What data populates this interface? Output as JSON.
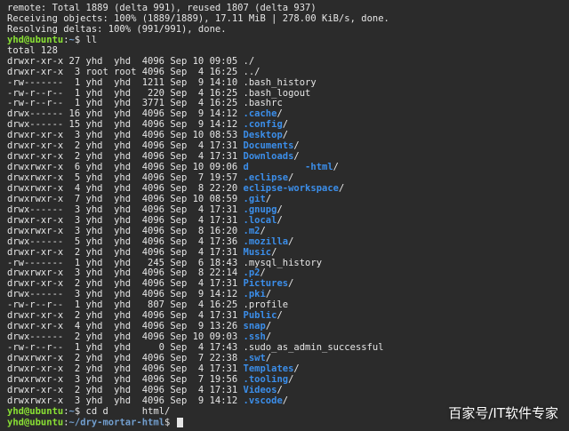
{
  "output_lines": [
    "remote: Total 1889 (delta 991), reused 1807 (delta 937)",
    "Receiving objects: 100% (1889/1889), 17.11 MiB | 278.00 KiB/s, done.",
    "Resolving deltas: 100% (991/991), done."
  ],
  "prompt1": {
    "user": "yhd@ubuntu",
    "sep": ":",
    "path": "~",
    "symbol": "$ ",
    "command": "ll"
  },
  "total": "total 128",
  "listing": [
    {
      "meta": "drwxr-xr-x 27 yhd  yhd  4096 Sep 10 09:05 ",
      "name": "./",
      "dir": false
    },
    {
      "meta": "drwxr-xr-x  3 root root 4096 Sep  4 16:25 ",
      "name": "../",
      "dir": false
    },
    {
      "meta": "-rw-------  1 yhd  yhd  1211 Sep  9 14:10 ",
      "name": ".bash_history",
      "dir": false
    },
    {
      "meta": "-rw-r--r--  1 yhd  yhd   220 Sep  4 16:25 ",
      "name": ".bash_logout",
      "dir": false
    },
    {
      "meta": "-rw-r--r--  1 yhd  yhd  3771 Sep  4 16:25 ",
      "name": ".bashrc",
      "dir": false
    },
    {
      "meta": "drwx------ 16 yhd  yhd  4096 Sep  9 14:12 ",
      "name": ".cache",
      "dir": true
    },
    {
      "meta": "drwx------ 15 yhd  yhd  4096 Sep  9 14:12 ",
      "name": ".config",
      "dir": true
    },
    {
      "meta": "drwxr-xr-x  3 yhd  yhd  4096 Sep 10 08:53 ",
      "name": "Desktop",
      "dir": true
    },
    {
      "meta": "drwxr-xr-x  2 yhd  yhd  4096 Sep  4 17:31 ",
      "name": "Documents",
      "dir": true
    },
    {
      "meta": "drwxr-xr-x  2 yhd  yhd  4096 Sep  4 17:31 ",
      "name": "Downloads",
      "dir": true
    },
    {
      "meta": "drwxrwxr-x  6 yhd  yhd  4096 Sep 10 09:06 ",
      "name": "d          -html",
      "dir": true
    },
    {
      "meta": "drwxrwxr-x  5 yhd  yhd  4096 Sep  7 19:57 ",
      "name": ".eclipse",
      "dir": true
    },
    {
      "meta": "drwxrwxr-x  4 yhd  yhd  4096 Sep  8 22:20 ",
      "name": "eclipse-workspace",
      "dir": true
    },
    {
      "meta": "drwxrwxr-x  7 yhd  yhd  4096 Sep 10 08:59 ",
      "name": ".git",
      "dir": true
    },
    {
      "meta": "drwx------  3 yhd  yhd  4096 Sep  4 17:31 ",
      "name": ".gnupg",
      "dir": true
    },
    {
      "meta": "drwxr-xr-x  3 yhd  yhd  4096 Sep  4 17:31 ",
      "name": ".local",
      "dir": true
    },
    {
      "meta": "drwxrwxr-x  3 yhd  yhd  4096 Sep  8 16:20 ",
      "name": ".m2",
      "dir": true
    },
    {
      "meta": "drwx------  5 yhd  yhd  4096 Sep  4 17:36 ",
      "name": ".mozilla",
      "dir": true
    },
    {
      "meta": "drwxr-xr-x  2 yhd  yhd  4096 Sep  4 17:31 ",
      "name": "Music",
      "dir": true
    },
    {
      "meta": "-rw-------  1 yhd  yhd   245 Sep  6 18:43 ",
      "name": ".mysql_history",
      "dir": false
    },
    {
      "meta": "drwxrwxr-x  3 yhd  yhd  4096 Sep  8 22:14 ",
      "name": ".p2",
      "dir": true
    },
    {
      "meta": "drwxr-xr-x  2 yhd  yhd  4096 Sep  4 17:31 ",
      "name": "Pictures",
      "dir": true
    },
    {
      "meta": "drwx------  3 yhd  yhd  4096 Sep  9 14:12 ",
      "name": ".pki",
      "dir": true
    },
    {
      "meta": "-rw-r--r--  1 yhd  yhd   807 Sep  4 16:25 ",
      "name": ".profile",
      "dir": false
    },
    {
      "meta": "drwxr-xr-x  2 yhd  yhd  4096 Sep  4 17:31 ",
      "name": "Public",
      "dir": true
    },
    {
      "meta": "drwxr-xr-x  4 yhd  yhd  4096 Sep  9 13:26 ",
      "name": "snap",
      "dir": true
    },
    {
      "meta": "drwx------  2 yhd  yhd  4096 Sep 10 09:03 ",
      "name": ".ssh",
      "dir": true
    },
    {
      "meta": "-rw-r--r--  1 yhd  yhd     0 Sep  4 17:43 ",
      "name": ".sudo_as_admin_successful",
      "dir": false
    },
    {
      "meta": "drwxrwxr-x  2 yhd  yhd  4096 Sep  7 22:38 ",
      "name": ".swt",
      "dir": true
    },
    {
      "meta": "drwxr-xr-x  2 yhd  yhd  4096 Sep  4 17:31 ",
      "name": "Templates",
      "dir": true
    },
    {
      "meta": "drwxrwxr-x  3 yhd  yhd  4096 Sep  7 19:56 ",
      "name": ".tooling",
      "dir": true
    },
    {
      "meta": "drwxr-xr-x  2 yhd  yhd  4096 Sep  4 17:31 ",
      "name": "Videos",
      "dir": true
    },
    {
      "meta": "drwxrwxr-x  3 yhd  yhd  4096 Sep  9 14:12 ",
      "name": ".vscode",
      "dir": true
    }
  ],
  "prompt2": {
    "user": "yhd@ubuntu",
    "sep": ":",
    "path": "~",
    "symbol": "$ ",
    "command": "cd d      ",
    "command_tail": "html/"
  },
  "prompt3": {
    "user": "yhd@ubuntu",
    "sep": ":",
    "path": "~/dry-mortar-html",
    "symbol": "$ "
  },
  "watermark": "百家号/IT软件专家",
  "colors": {
    "background": "#2b2b2b",
    "text": "#e6e6e6",
    "prompt_user": "#8ae234",
    "prompt_path": "#729fcf",
    "directory": "#3b8eea"
  }
}
